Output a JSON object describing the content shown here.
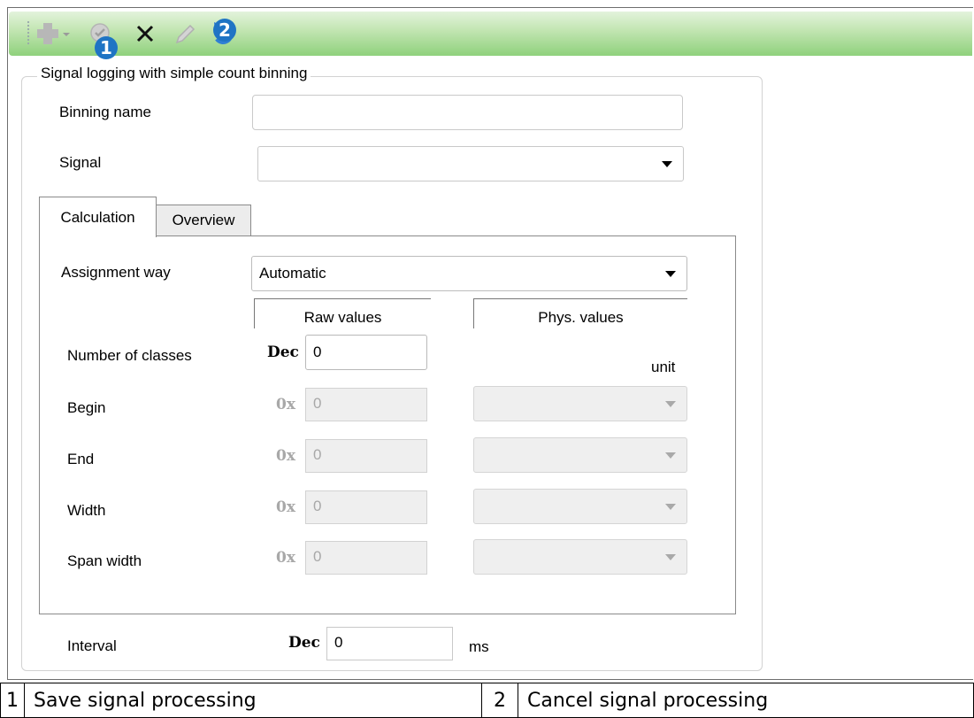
{
  "toolbar": {
    "badges": [
      "1",
      "2"
    ],
    "icons": [
      "add-icon",
      "save-icon",
      "delete-icon",
      "edit-icon",
      "undo-icon"
    ]
  },
  "group": {
    "title": "Signal logging with simple count binning",
    "binning_name_label": "Binning name",
    "binning_name_value": "",
    "signal_label": "Signal",
    "signal_value": ""
  },
  "tabs": [
    {
      "label": "Calculation",
      "active": true
    },
    {
      "label": "Overview",
      "active": false
    }
  ],
  "calculation": {
    "assignment_label": "Assignment way",
    "assignment_value": "Automatic",
    "raw_header": "Raw values",
    "phys_header": "Phys. values",
    "unit_label": "unit",
    "classes_label": "Number of classes",
    "classes_prefix": "Dec",
    "classes_value": "0",
    "rows": [
      {
        "label": "Begin",
        "prefix": "0x",
        "value": "0"
      },
      {
        "label": "End",
        "prefix": "0x",
        "value": "0"
      },
      {
        "label": "Width",
        "prefix": "0x",
        "value": "0"
      },
      {
        "label": "Span width",
        "prefix": "0x",
        "value": "0"
      }
    ]
  },
  "interval": {
    "label": "Interval",
    "prefix": "Dec",
    "value": "0",
    "unit": "ms"
  },
  "legend": [
    {
      "number": "1",
      "text": "Save signal processing"
    },
    {
      "number": "2",
      "text": "Cancel signal processing"
    }
  ]
}
